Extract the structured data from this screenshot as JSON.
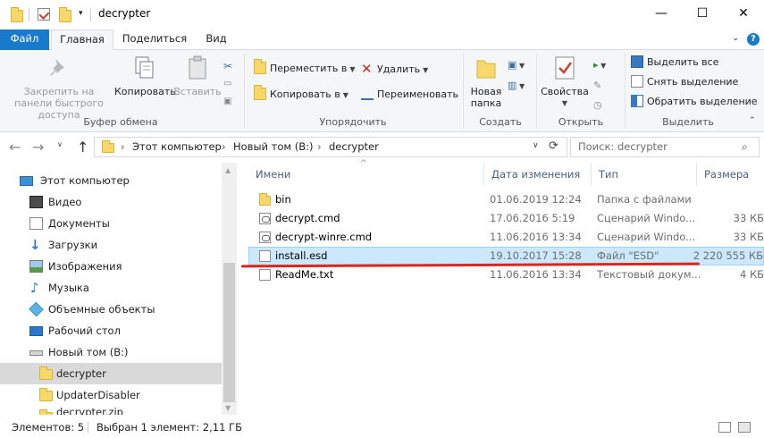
{
  "window": {
    "title": "decrypter",
    "minimize": "—",
    "maximize": "☐",
    "close": "✕"
  },
  "tabs": {
    "file": "Файл",
    "home": "Главная",
    "share": "Поделиться",
    "view": "Вид"
  },
  "ribbon": {
    "clipboard": {
      "pin": "Закрепить на панели быстрого доступа",
      "copy": "Копировать",
      "paste": "Вставить",
      "label": "Буфер обмена"
    },
    "organize": {
      "move_to": "Переместить в",
      "copy_to": "Копировать в",
      "delete": "Удалить",
      "rename": "Переименовать",
      "label": "Упорядочить"
    },
    "new": {
      "new_folder": "Новая папка",
      "label": "Создать"
    },
    "open": {
      "properties": "Свойства",
      "label": "Открыть"
    },
    "select": {
      "select_all": "Выделить все",
      "select_none": "Снять выделение",
      "invert": "Обратить выделение",
      "label": "Выделить"
    }
  },
  "address": {
    "crumbs": [
      "Этот компьютер",
      "Новый том (B:)",
      "decrypter"
    ],
    "search_placeholder": "Поиск: decrypter"
  },
  "nav_pane": {
    "items": [
      {
        "label": "Этот компьютер",
        "icon": "computer-icon"
      },
      {
        "label": "Видео",
        "icon": "video-icon"
      },
      {
        "label": "Документы",
        "icon": "documents-icon"
      },
      {
        "label": "Загрузки",
        "icon": "downloads-icon"
      },
      {
        "label": "Изображения",
        "icon": "pictures-icon"
      },
      {
        "label": "Музыка",
        "icon": "music-icon"
      },
      {
        "label": "Объемные объекты",
        "icon": "3d-objects-icon"
      },
      {
        "label": "Рабочий стол",
        "icon": "desktop-icon"
      },
      {
        "label": "Новый том (B:)",
        "icon": "drive-icon"
      },
      {
        "label": "decrypter",
        "icon": "folder-icon"
      },
      {
        "label": "UpdaterDisabler",
        "icon": "folder-icon"
      },
      {
        "label": "decrypter.zip",
        "icon": "zip-icon"
      }
    ]
  },
  "columns": {
    "name": "Имени",
    "date": "Дата изменения",
    "type": "Тип",
    "size": "Размера"
  },
  "files": [
    {
      "name": "bin",
      "date": "01.06.2019 12:24",
      "type": "Папка с файлами",
      "size": "",
      "icon": "folder-icon"
    },
    {
      "name": "decrypt.cmd",
      "date": "17.06.2016 5:19",
      "type": "Сценарий Windo...",
      "size": "33 КБ",
      "icon": "cmd-icon"
    },
    {
      "name": "decrypt-winre.cmd",
      "date": "11.06.2016 13:34",
      "type": "Сценарий Windo...",
      "size": "33 КБ",
      "icon": "cmd-icon"
    },
    {
      "name": "install.esd",
      "date": "19.10.2017 15:28",
      "type": "Файл \"ESD\"",
      "size": "2 220 555 КБ",
      "icon": "file-icon"
    },
    {
      "name": "ReadMe.txt",
      "date": "11.06.2016 13:34",
      "type": "Текстовый докум...",
      "size": "4 КБ",
      "icon": "text-file-icon"
    }
  ],
  "status": {
    "items": "Элементов: 5",
    "selected": "Выбран 1 элемент: 2,11 ГБ"
  },
  "colors": {
    "accent": "#1979ca",
    "selection": "#cce8ff",
    "annotation": "#e2231a"
  }
}
